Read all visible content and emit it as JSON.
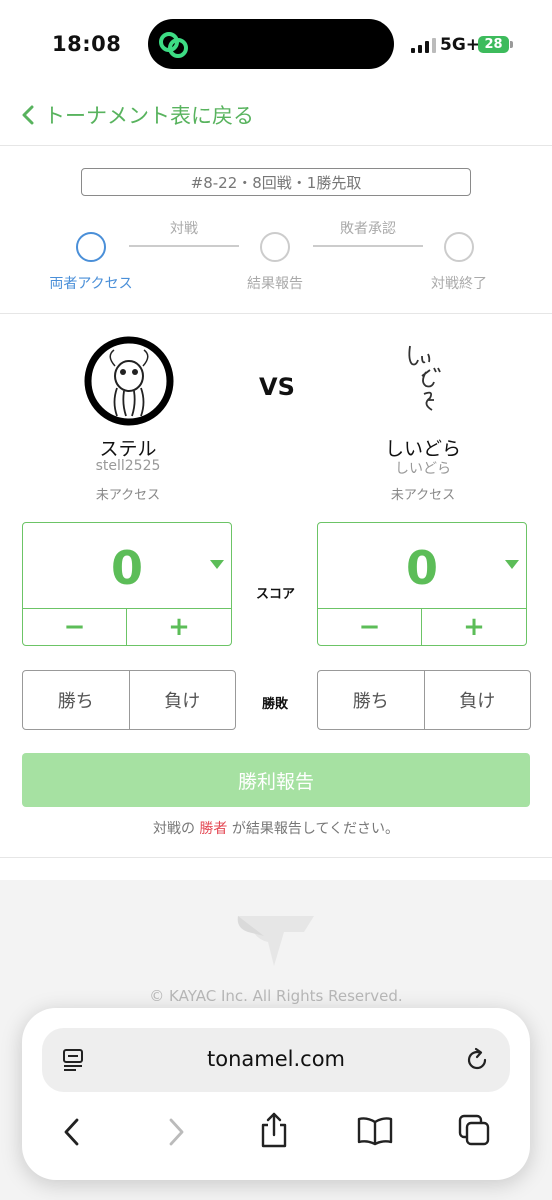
{
  "status_bar": {
    "time": "18:08",
    "network": "5G+",
    "battery": "28"
  },
  "nav": {
    "back_label": "トーナメント表に戻る"
  },
  "match": {
    "info": "#8-22・8回戦・1勝先取",
    "steps": [
      {
        "label": "両者アクセス",
        "active": true
      },
      {
        "label": "結果報告",
        "active": false
      },
      {
        "label": "対戦終了",
        "active": false
      }
    ],
    "step_connectors": [
      "対戦",
      "敗者承認"
    ]
  },
  "players": {
    "left": {
      "name": "ステル",
      "handle": "stell2525",
      "access": "未アクセス"
    },
    "right": {
      "name": "しいどら",
      "handle": "しいどら",
      "access": "未アクセス",
      "avatar_text": "しいどら"
    }
  },
  "vs_label": "VS",
  "score": {
    "label": "スコア",
    "left_value": "0",
    "right_value": "0",
    "minus": "−",
    "plus": "+"
  },
  "result": {
    "label": "勝敗",
    "win": "勝ち",
    "lose": "負け"
  },
  "report": {
    "button_label": "勝利報告",
    "note_before": "対戦の",
    "note_highlight": "勝者",
    "note_after": "が結果報告してください。"
  },
  "footer": {
    "copyright": "© KAYAC Inc. All Rights Reserved."
  },
  "browser": {
    "url": "tonamel.com"
  },
  "colors": {
    "accent_green": "#5cbd58",
    "active_blue": "#4a8fd8",
    "highlight_red": "#e44a55",
    "report_button": "#a6e1a2"
  }
}
